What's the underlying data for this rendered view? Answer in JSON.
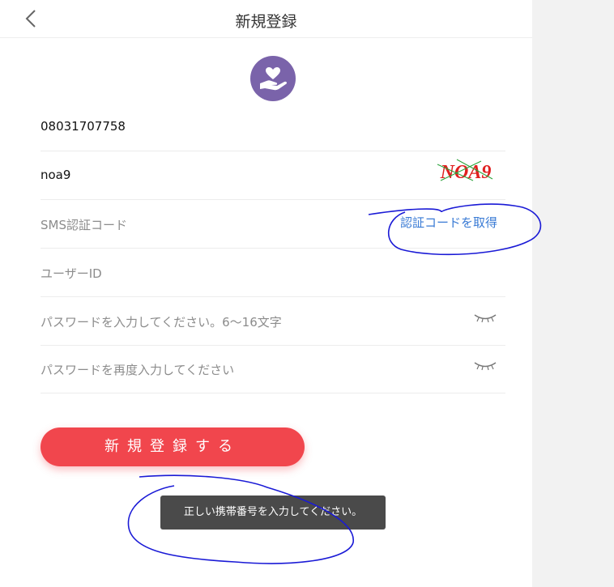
{
  "header": {
    "title": "新規登録",
    "back_icon": "chevron-left-icon"
  },
  "logo": {
    "icon": "hand-heart-icon",
    "color": "#7a63aa"
  },
  "form": {
    "phone": {
      "value": "08031707758"
    },
    "captcha": {
      "value": "noa9",
      "image_text": "NOA9",
      "image_color": "#e02020"
    },
    "sms_code": {
      "placeholder": "SMS認証コード",
      "action_label": "認証コードを取得",
      "action_color": "#3a7bd5"
    },
    "user_id": {
      "placeholder": "ユーザーID"
    },
    "password": {
      "placeholder": "パスワードを入力してください。6～16文字",
      "toggle_icon": "eye-closed-icon"
    },
    "password_confirm": {
      "placeholder": "パスワードを再度入力してください",
      "toggle_icon": "eye-closed-icon"
    }
  },
  "submit": {
    "label": "新規登録する",
    "color": "#f1464d"
  },
  "toast": {
    "message": "正しい携帯番号を入力してください。"
  },
  "annotation_color": "#1a1ad6"
}
